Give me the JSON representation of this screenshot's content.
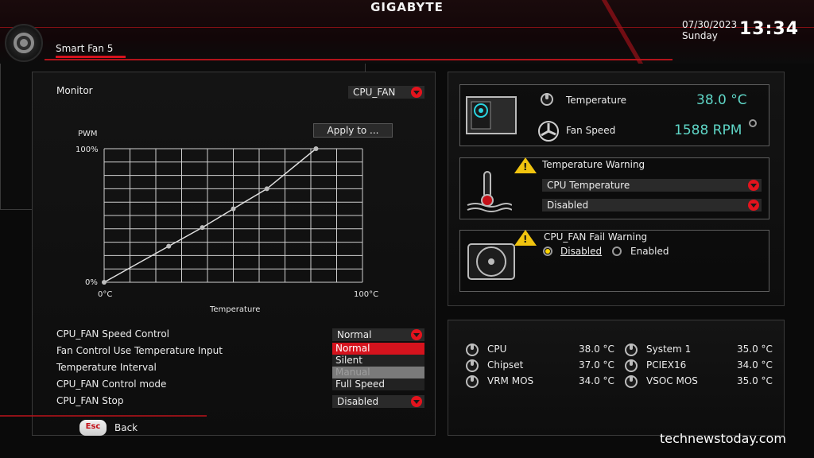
{
  "header": {
    "brand": "GIGABYTE",
    "date": "07/30/2023",
    "day": "Sunday",
    "time": "13:34",
    "tab": "Smart Fan 5"
  },
  "monitor": {
    "label": "Monitor",
    "fan_select": "CPU_FAN",
    "apply_button": "Apply to ..."
  },
  "chart_data": {
    "type": "line",
    "ylabel": "PWM",
    "xlabel": "Temperature",
    "x_ticks": [
      "0°C",
      "100°C"
    ],
    "y_ticks": [
      "0%",
      "100%"
    ],
    "grid": true,
    "series": [
      {
        "x": [
          0,
          25,
          38,
          50,
          63,
          82
        ],
        "values": [
          0,
          27,
          41,
          55,
          70,
          100
        ]
      }
    ],
    "xlim": [
      0,
      100
    ],
    "ylim": [
      0,
      100
    ]
  },
  "settings": {
    "rows": [
      {
        "label": "CPU_FAN Speed Control",
        "value": "Normal"
      },
      {
        "label": "Fan Control Use Temperature Input",
        "value": ""
      },
      {
        "label": "Temperature Interval",
        "value": ""
      },
      {
        "label": "CPU_FAN Control mode",
        "value": ""
      },
      {
        "label": "CPU_FAN Stop",
        "value": "Disabled"
      }
    ],
    "speed_options": [
      "Normal",
      "Silent",
      "Manual",
      "Full Speed"
    ],
    "selected_option": "Normal",
    "disabled_option": "Manual"
  },
  "status": {
    "temperature_label": "Temperature",
    "temperature_value": "38.0 °C",
    "fan_speed_label": "Fan Speed",
    "fan_speed_value": "1588 RPM"
  },
  "temp_warning": {
    "title": "Temperature Warning",
    "source": "CPU Temperature",
    "state": "Disabled"
  },
  "fan_fail_warning": {
    "title": "CPU_FAN Fail Warning",
    "option_disabled": "Disabled",
    "option_enabled": "Enabled",
    "selected": "Disabled"
  },
  "temps": [
    {
      "name": "CPU",
      "value": "38.0 °C"
    },
    {
      "name": "Chipset",
      "value": "37.0 °C"
    },
    {
      "name": "VRM MOS",
      "value": "34.0 °C"
    },
    {
      "name": "System 1",
      "value": "35.0 °C"
    },
    {
      "name": "PCIEX16",
      "value": "34.0 °C"
    },
    {
      "name": "VSOC MOS",
      "value": "35.0 °C"
    }
  ],
  "footer": {
    "esc_key": "Esc",
    "back_label": "Back",
    "watermark": "technewstoday.com"
  },
  "colors": {
    "accent_red": "#d5131d",
    "value_teal": "#5fd6c7",
    "warning_yellow": "#f1c40f"
  }
}
